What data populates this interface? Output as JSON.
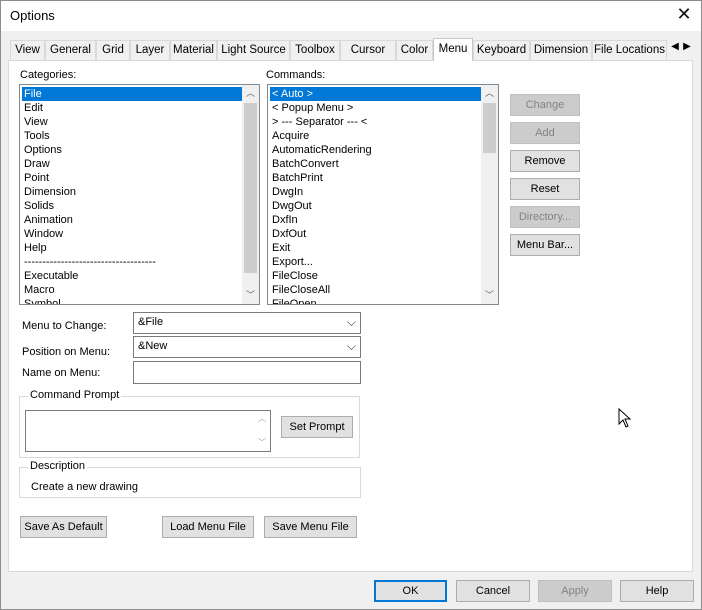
{
  "window": {
    "title": "Options"
  },
  "tabs": [
    {
      "label": "View"
    },
    {
      "label": "General"
    },
    {
      "label": "Grid"
    },
    {
      "label": "Layer"
    },
    {
      "label": "Material"
    },
    {
      "label": "Light Source"
    },
    {
      "label": "Toolbox"
    },
    {
      "label": "Cursor"
    },
    {
      "label": "Color"
    },
    {
      "label": "Menu"
    },
    {
      "label": "Keyboard"
    },
    {
      "label": "Dimension"
    },
    {
      "label": "File Locations"
    }
  ],
  "active_tab": "Menu",
  "categories": {
    "label": "Categories:",
    "items": [
      "File",
      "Edit",
      "View",
      "Tools",
      "Options",
      "Draw",
      "Point",
      "Dimension",
      "Solids",
      "Animation",
      "Window",
      "Help",
      "------------------------------------",
      "Executable",
      "Macro",
      "Symbol"
    ],
    "selected": "File"
  },
  "commands": {
    "label": "Commands:",
    "items": [
      "< Auto >",
      "< Popup Menu >",
      "> --- Separator --- <",
      "Acquire",
      "AutomaticRendering",
      "BatchConvert",
      "BatchPrint",
      "DwgIn",
      "DwgOut",
      "DxfIn",
      "DxfOut",
      "Exit",
      "Export...",
      "FileClose",
      "FileCloseAll",
      "FileOpen"
    ],
    "selected": "< Auto >"
  },
  "side_buttons": {
    "change": "Change",
    "add": "Add",
    "remove": "Remove",
    "reset": "Reset",
    "directory": "Directory...",
    "menu_bar": "Menu Bar..."
  },
  "form": {
    "menu_to_change_label": "Menu to Change:",
    "menu_to_change_value": "&File",
    "position_on_menu_label": "Position on Menu:",
    "position_on_menu_value": "&New",
    "name_on_menu_label": "Name on Menu:",
    "name_on_menu_value": ""
  },
  "command_prompt": {
    "legend": "Command Prompt",
    "value": "",
    "set_prompt_label": "Set Prompt"
  },
  "description": {
    "legend": "Description",
    "text": "Create a new drawing"
  },
  "bottom_buttons": {
    "save_as_default": "Save As Default",
    "load_menu_file": "Load Menu File",
    "save_menu_file": "Save Menu File"
  },
  "dialog_buttons": {
    "ok": "OK",
    "cancel": "Cancel",
    "apply": "Apply",
    "help": "Help"
  },
  "icons": {
    "close": "close-icon",
    "tab_left": "chevron-left-icon",
    "tab_right": "chevron-right-icon",
    "scroll_up": "chevron-up-icon",
    "scroll_down": "chevron-down-icon",
    "combo": "chevron-down-icon",
    "cursor": "mouse-pointer-icon"
  },
  "colors": {
    "selection": "#0078d7",
    "window_bg": "#f0f0f0",
    "panel_bg": "#ffffff"
  }
}
